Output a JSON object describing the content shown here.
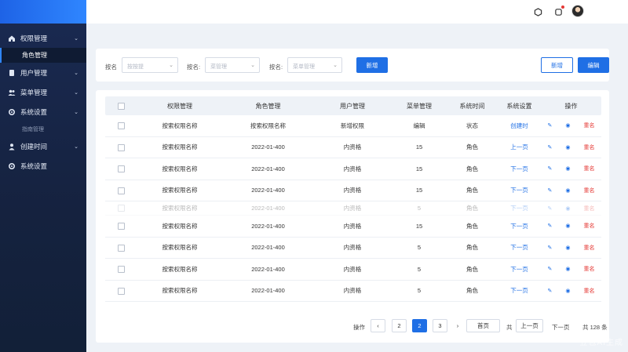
{
  "sidebar": {
    "items": [
      {
        "label": "权限管理",
        "icon": "home-icon",
        "expanded": true,
        "children": [
          {
            "label": "角色管理",
            "active": true
          }
        ]
      },
      {
        "label": "用户管理",
        "icon": "document-icon"
      },
      {
        "label": "菜单管理",
        "icon": "users-icon"
      },
      {
        "label": "系统设置",
        "icon": "gear-icon",
        "expanded": true,
        "children": [
          {
            "label": "指南管理",
            "active": false
          }
        ]
      },
      {
        "label": "创建时间",
        "icon": "user-icon"
      },
      {
        "label": "系统设置",
        "icon": "gear-icon"
      }
    ]
  },
  "header": {
    "icons": [
      "hexagon-icon",
      "notification-icon",
      "avatar"
    ]
  },
  "filters": {
    "label1": "按名",
    "select1_placeholder": "按按提",
    "label2": "按名:",
    "select2_placeholder": "菜管理",
    "label3": "按名:",
    "select3_placeholder": "菜单管理",
    "add_label": "新增",
    "add2_label": "新增",
    "edit_label": "编辑"
  },
  "table": {
    "columns": [
      "权限管理",
      "角色管理",
      "用户管理",
      "菜单管理",
      "系统时间",
      "系统设置",
      "操作"
    ],
    "rows": [
      [
        "按索权限名称",
        "按索权限名称",
        "新增权限",
        "编辑",
        "状态",
        "创建时"
      ],
      [
        "按索权限名称",
        "2022-01-400",
        "内资格",
        "15",
        "角色",
        "上一页"
      ],
      [
        "按索权限名称",
        "2022-01-400",
        "内资格",
        "15",
        "角色",
        "下一页"
      ],
      [
        "按索权限名称",
        "2022-01-400",
        "内资格",
        "15",
        "角色",
        "下一页"
      ],
      [
        "按索权限名称",
        "2022-01-400",
        "内资格",
        "5",
        "角色",
        "下一页"
      ],
      [
        "按索权限名称",
        "2022-01-400",
        "内资格",
        "15",
        "角色",
        "下一页"
      ],
      [
        "按索权限名称",
        "2022-01-400",
        "内资格",
        "5",
        "角色",
        "下一页"
      ],
      [
        "按索权限名称",
        "2022-01-400",
        "内资格",
        "5",
        "角色",
        "下一页"
      ],
      [
        "按索权限名称",
        "2022-01-400",
        "内资格",
        "5",
        "角色",
        "下一页"
      ]
    ],
    "ops": {
      "edit": "✎",
      "view": "◉",
      "delete": "重名"
    }
  },
  "pager": {
    "label": "操作",
    "pages": [
      "2",
      "2",
      "3"
    ],
    "active_index": 1,
    "home_label": "首页",
    "total_label": "共",
    "prev_label": "上一页",
    "next_label": "下一页",
    "count_label": "共 128 条"
  },
  "watermark": "豆包AI生成",
  "colors": {
    "accent": "#1f6fe5",
    "danger": "#e53935",
    "sidebar": "#1a2a52"
  }
}
